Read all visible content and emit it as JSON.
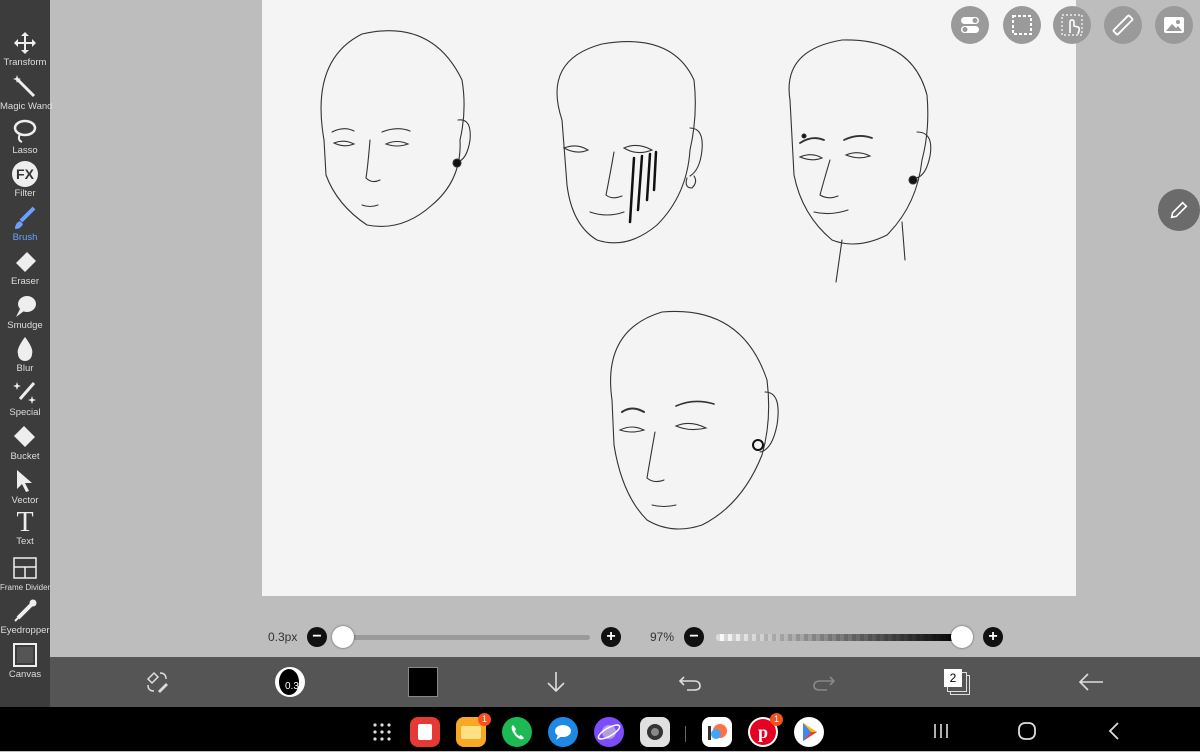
{
  "toolbar": {
    "tools": [
      {
        "label": "Transform"
      },
      {
        "label": "Magic Wand"
      },
      {
        "label": "Lasso"
      },
      {
        "label": "Filter"
      },
      {
        "label": "Brush"
      },
      {
        "label": "Eraser"
      },
      {
        "label": "Smudge"
      },
      {
        "label": "Blur"
      },
      {
        "label": "Special"
      },
      {
        "label": "Bucket"
      },
      {
        "label": "Vector"
      },
      {
        "label": "Text"
      },
      {
        "label": "Frame Divider"
      },
      {
        "label": "Eyedropper"
      },
      {
        "label": "Canvas"
      }
    ],
    "filter_icon_text": "FX",
    "text_icon_glyph": "T",
    "active_tool": "Brush"
  },
  "sliders": {
    "brush_size": {
      "value_label": "0.3px",
      "level": 0.0
    },
    "opacity": {
      "value_label": "97%",
      "level": 0.97
    },
    "minus": "−",
    "plus": "+"
  },
  "bottom_bar": {
    "brush_preview_label": "0.3",
    "color_swatch": "#000000",
    "layers_count": "2"
  },
  "nav": {
    "apps": [
      {
        "name": "Samsung Notes",
        "color": "#e53935"
      },
      {
        "name": "My Files",
        "color": "#f9a825",
        "badge": "1"
      },
      {
        "name": "Phone",
        "color": "#1db954"
      },
      {
        "name": "Messages",
        "color": "#1e88e5"
      },
      {
        "name": "Internet",
        "color": "#7c4dff"
      },
      {
        "name": "Camera",
        "color": "#e0e0e0"
      },
      {
        "name": "ibisPaint",
        "color": "#ffffff"
      },
      {
        "name": "Pinterest",
        "color": "#e60023",
        "badge": "1"
      },
      {
        "name": "Play Store",
        "color": "#ffffff"
      }
    ]
  },
  "colors": {
    "toolbar_bg": "#3c3c3c",
    "active": "#6aa0ff",
    "canvas": "#f4f4f4",
    "workspace": "#bdbdbd"
  }
}
